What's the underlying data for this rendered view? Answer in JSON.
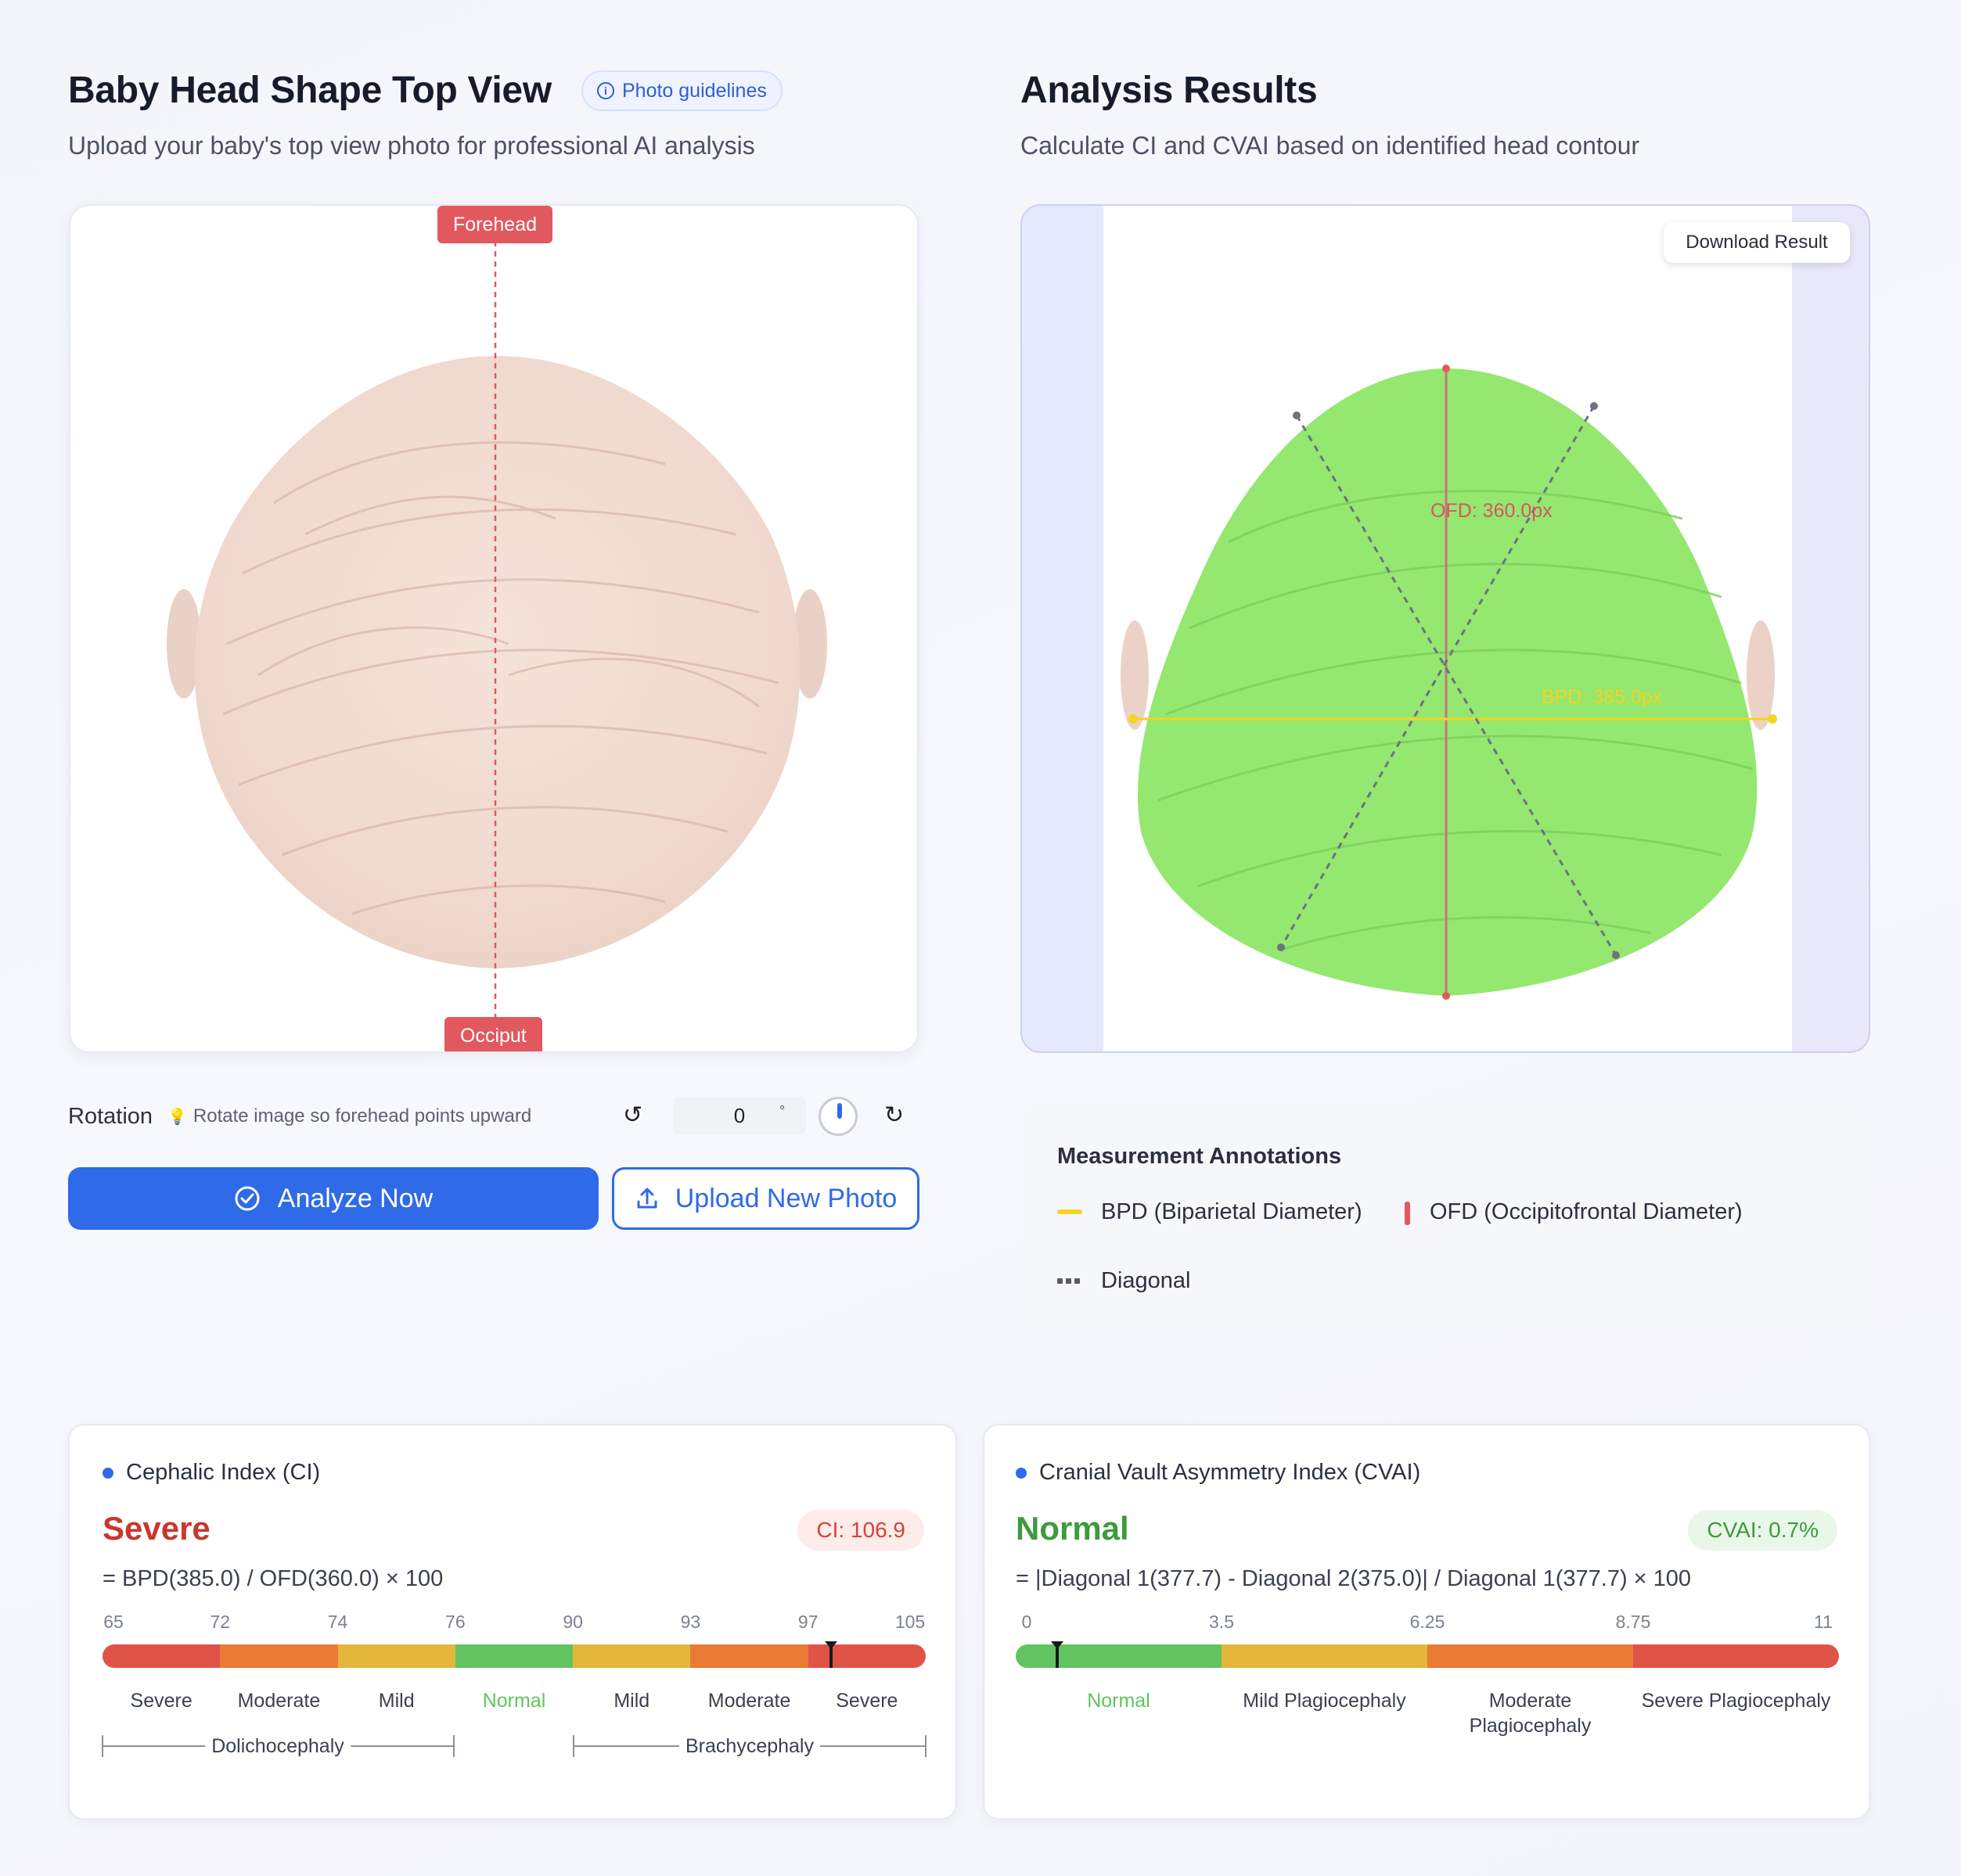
{
  "upload": {
    "title": "Baby Head Shape Top View",
    "guidelines_label": "Photo guidelines",
    "subtitle": "Upload your baby's top view photo for professional AI analysis",
    "forehead_label": "Forehead",
    "occiput_label": "Occiput"
  },
  "rotation": {
    "label": "Rotation",
    "hint": "Rotate image so forehead points upward",
    "value": "0",
    "unit": "°"
  },
  "actions": {
    "analyze_label": "Analyze Now",
    "upload_label": "Upload New Photo"
  },
  "results": {
    "title": "Analysis Results",
    "subtitle": "Calculate CI and CVAI based on identified head contour",
    "download_label": "Download Result",
    "ofd_overlay": "OFD: 360.0px",
    "bpd_overlay": "BPD: 385.0px"
  },
  "annotations": {
    "title": "Measurement Annotations",
    "bpd": "BPD (Biparietal Diameter)",
    "ofd": "OFD (Occipitofrontal Diameter)",
    "diagonal": "Diagonal",
    "bpd_color": "#f5d323",
    "ofd_color": "#e2585f",
    "diagonal_color": "#6b7280"
  },
  "ci": {
    "title": "Cephalic Index (CI)",
    "status": "Severe",
    "status_color": "#c8372d",
    "badge": "CI: 106.9",
    "value": 106.9,
    "formula": "= BPD(385.0) / OFD(360.0) × 100",
    "ticks": [
      "65",
      "72",
      "74",
      "76",
      "90",
      "93",
      "97",
      "105"
    ],
    "segments": [
      "Severe",
      "Moderate",
      "Mild",
      "Normal",
      "Mild",
      "Moderate",
      "Severe"
    ],
    "groups": [
      "Dolichocephaly",
      "Brachycephaly"
    ]
  },
  "cvai": {
    "title": "Cranial Vault Asymmetry Index (CVAI)",
    "status": "Normal",
    "status_color": "#3d9a3f",
    "badge": "CVAI: 0.7%",
    "value": 0.7,
    "formula": "= |Diagonal 1(377.7) - Diagonal 2(375.0)| / Diagonal 1(377.7) × 100",
    "ticks": [
      "0",
      "3.5",
      "6.25",
      "8.75",
      "11"
    ],
    "segments": [
      "Normal",
      "Mild Plagiocephaly",
      "Moderate Plagiocephaly",
      "Severe Plagiocephaly"
    ]
  },
  "colors": {
    "severe": "#e05347",
    "moderate": "#ea7b35",
    "mild": "#e4b63a",
    "normal": "#62c460",
    "accent": "#2f6ae8"
  }
}
